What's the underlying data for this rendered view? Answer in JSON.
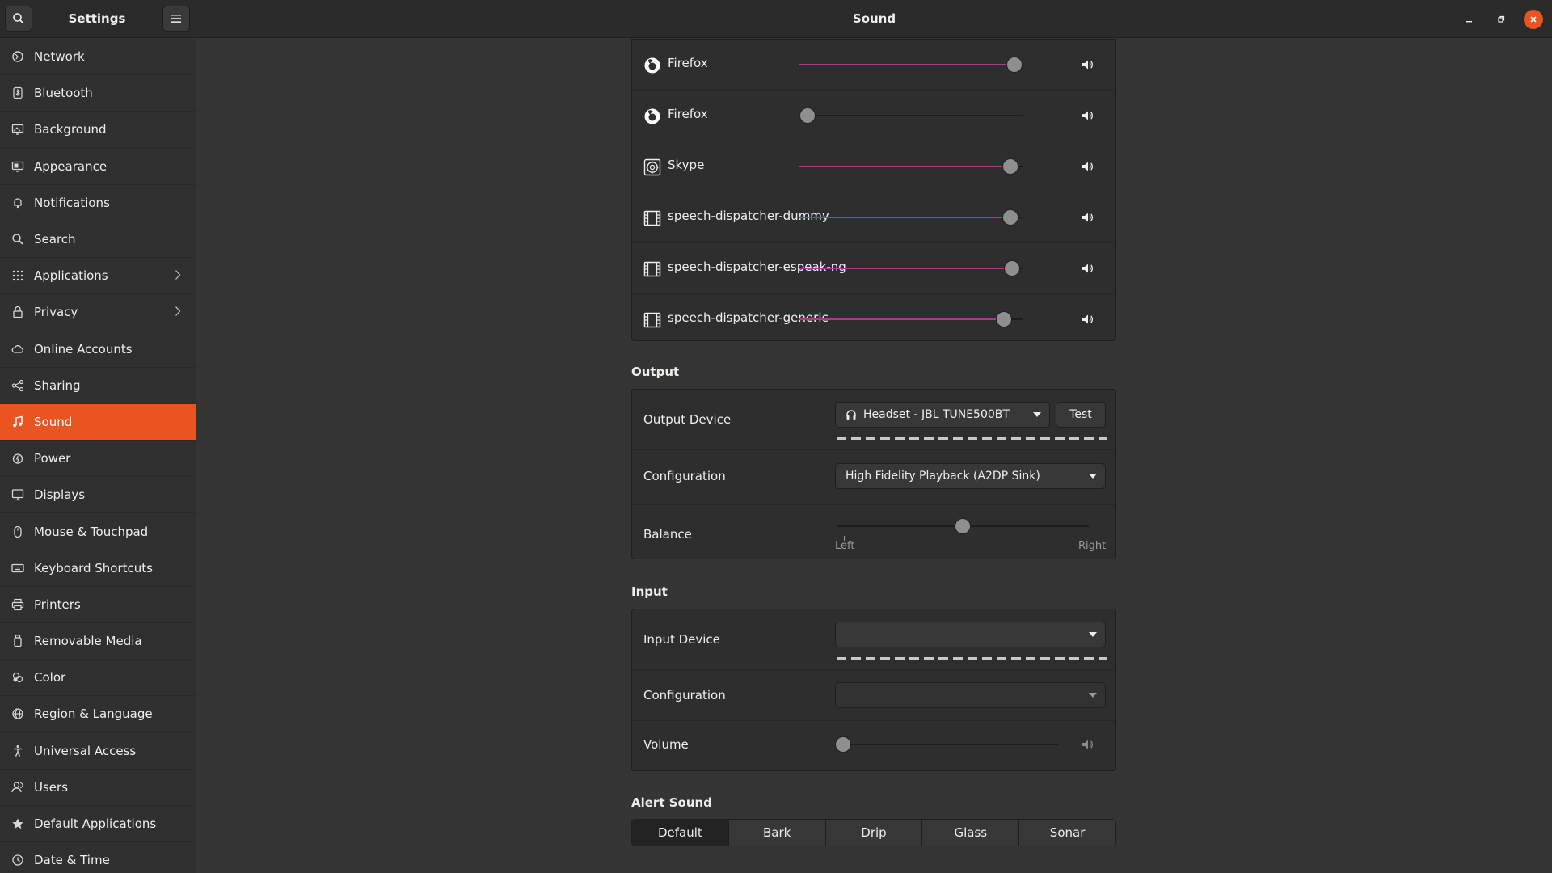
{
  "header": {
    "sidebar_title": "Settings",
    "title": "Sound"
  },
  "sidebar": {
    "items": [
      {
        "label": "Network",
        "icon": "network-icon"
      },
      {
        "label": "Bluetooth",
        "icon": "bluetooth-icon"
      },
      {
        "label": "Background",
        "icon": "background-icon"
      },
      {
        "label": "Appearance",
        "icon": "appearance-icon"
      },
      {
        "label": "Notifications",
        "icon": "bell-icon"
      },
      {
        "label": "Search",
        "icon": "search-icon"
      },
      {
        "label": "Applications",
        "icon": "apps-grid-icon"
      },
      {
        "label": "Privacy",
        "icon": "lock-icon"
      },
      {
        "label": "Online Accounts",
        "icon": "cloud-icon"
      },
      {
        "label": "Sharing",
        "icon": "share-icon"
      },
      {
        "label": "Sound",
        "icon": "music-note-icon"
      },
      {
        "label": "Power",
        "icon": "power-icon"
      },
      {
        "label": "Displays",
        "icon": "display-icon"
      },
      {
        "label": "Mouse & Touchpad",
        "icon": "mouse-icon"
      },
      {
        "label": "Keyboard Shortcuts",
        "icon": "keyboard-icon"
      },
      {
        "label": "Printers",
        "icon": "printer-icon"
      },
      {
        "label": "Removable Media",
        "icon": "usb-icon"
      },
      {
        "label": "Color",
        "icon": "color-icon"
      },
      {
        "label": "Region & Language",
        "icon": "globe-icon"
      },
      {
        "label": "Universal Access",
        "icon": "accessibility-icon"
      },
      {
        "label": "Users",
        "icon": "users-icon"
      },
      {
        "label": "Default Applications",
        "icon": "star-icon"
      },
      {
        "label": "Date & Time",
        "icon": "clock-icon"
      }
    ],
    "active": "Sound"
  },
  "apps": [
    {
      "name": "Firefox",
      "icon": "firefox-icon",
      "volume_pct": 100
    },
    {
      "name": "Firefox",
      "icon": "firefox-icon",
      "volume_pct": 0
    },
    {
      "name": "Skype",
      "icon": "skype-icon",
      "volume_pct": 98
    },
    {
      "name": "speech-dispatcher-dummy",
      "icon": "film-icon",
      "volume_pct": 98
    },
    {
      "name": "speech-dispatcher-espeak-ng",
      "icon": "film-icon",
      "volume_pct": 99
    },
    {
      "name": "speech-dispatcher-generic",
      "icon": "film-icon",
      "volume_pct": 95
    }
  ],
  "output": {
    "title": "Output",
    "device_label": "Output Device",
    "device_value": "Headset - JBL TUNE500BT",
    "test_label": "Test",
    "config_label": "Configuration",
    "config_value": "High Fidelity Playback (A2DP Sink)",
    "balance_label": "Balance",
    "balance_pct": 50,
    "left_label": "Left",
    "right_label": "Right"
  },
  "input": {
    "title": "Input",
    "device_label": "Input Device",
    "device_value": "",
    "config_label": "Configuration",
    "config_value": "",
    "volume_label": "Volume",
    "volume_pct": 0
  },
  "alert": {
    "title": "Alert Sound",
    "options": [
      "Default",
      "Bark",
      "Drip",
      "Glass",
      "Sonar"
    ],
    "selected": "Default"
  },
  "colors": {
    "accent": "#e95420",
    "slider_fill": "#a43d8f"
  }
}
